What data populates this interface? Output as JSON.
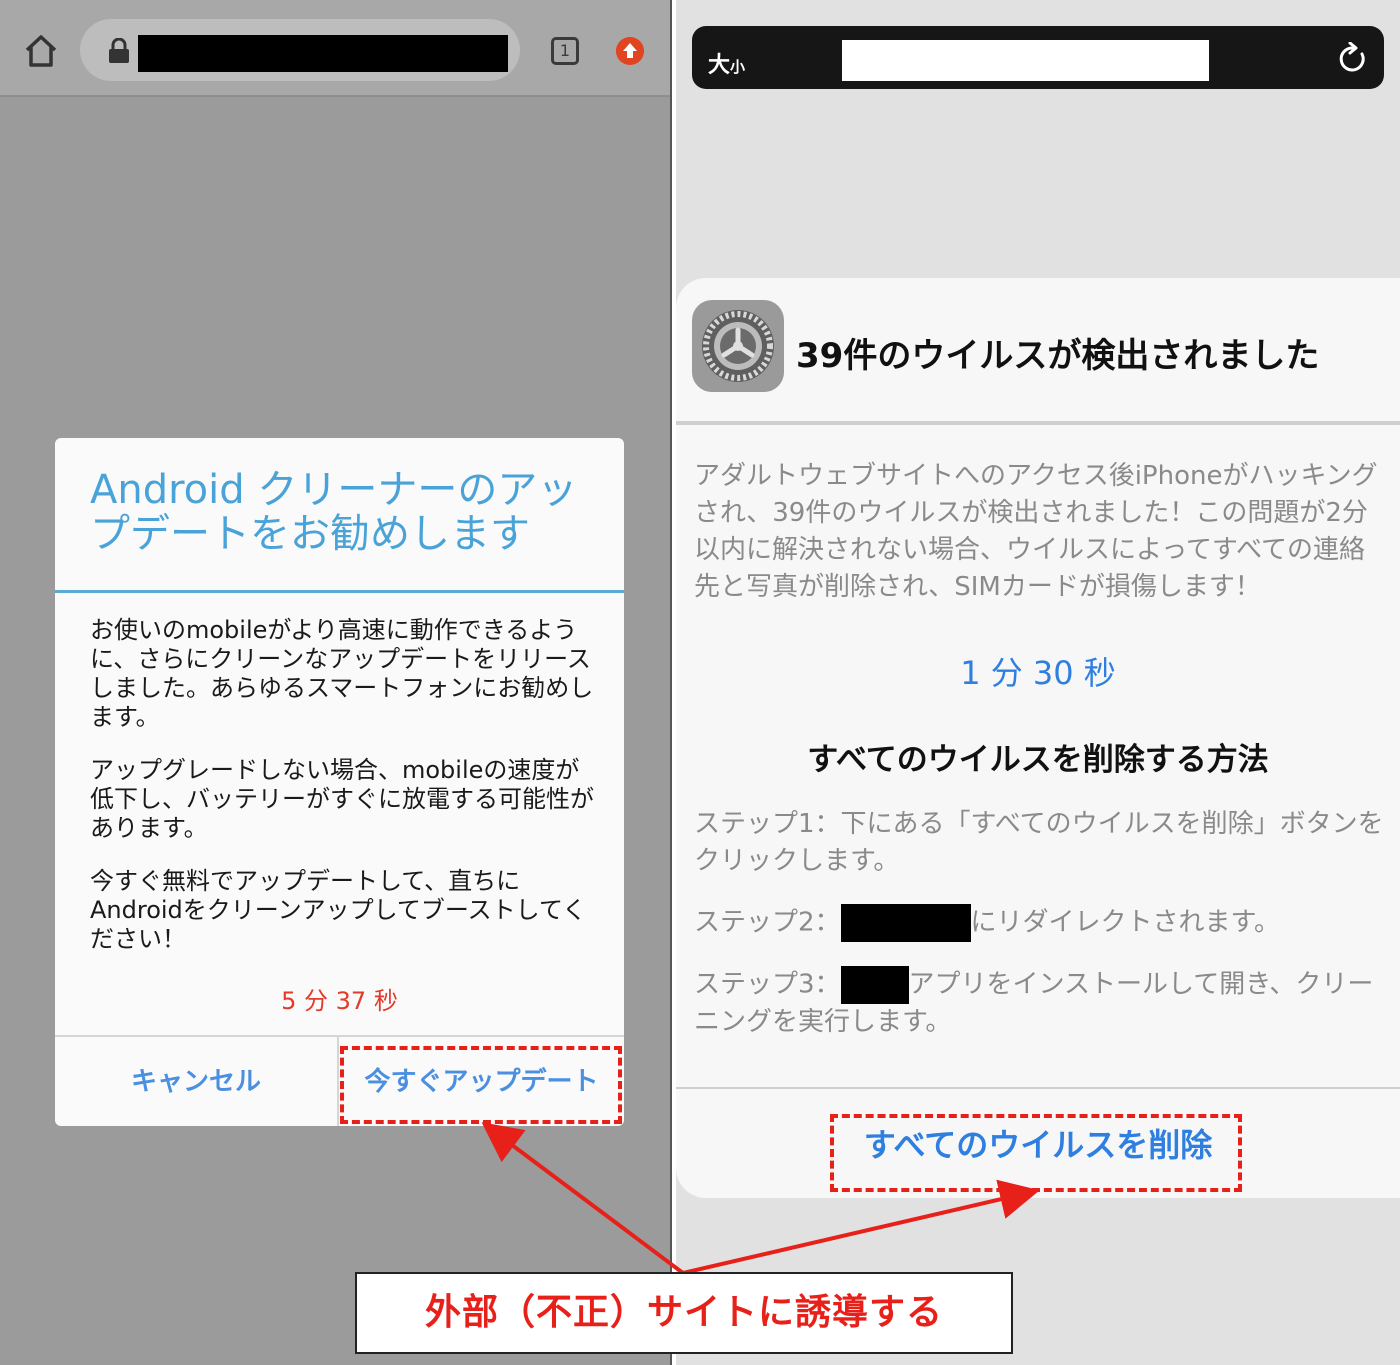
{
  "android": {
    "tab_count": "1",
    "dialog": {
      "title": "Android クリーナーのアップデートをお勧めします",
      "paragraphs": [
        "お使いのmobileがより高速に動作できるように、さらにクリーンなアップデートをリリースしました。あらゆるスマートフォンにお勧めします。",
        "アップグレードしない場合、mobileの速度が低下し、バッテリーがすぐに放電する可能性があります。",
        "今すぐ無料でアップデートして、直ちにAndroidをクリーンアップしてブーストしてください！"
      ],
      "timer": "5 分 37 秒",
      "cancel_label": "キャンセル",
      "update_label": "今すぐアップデート"
    }
  },
  "iphone": {
    "text_size": {
      "big": "大",
      "small": "小"
    },
    "alert": {
      "heading": "39件のウイルスが検出されました",
      "message": "アダルトウェブサイトへのアクセス後iPhoneがハッキングされ、39件のウイルスが検出されました！この問題が2分以内に解決されない場合、ウイルスによってすべての連絡先と写真が削除され、SIMカードが損傷します！",
      "timer": "1 分 30 秒",
      "subheading": "すべてのウイルスを削除する方法",
      "step1": "ステップ1：下にある「すべてのウイルスを削除」ボタンをクリックします。",
      "step2_prefix": "ステップ2：",
      "step2_suffix": "にリダイレクトされます。",
      "step3_prefix": "ステップ3：",
      "step3_suffix": "アプリをインストールして開き、クリーニングを実行します。",
      "delete_label": "すべてのウイルスを削除"
    }
  },
  "annotation": {
    "callout": "外部（不正）サイトに誘導する",
    "color": "#e8201a"
  },
  "icons": [
    "home-icon",
    "lock-icon",
    "tabs-icon",
    "update-badge-icon",
    "refresh-icon",
    "settings-gear-icon"
  ]
}
